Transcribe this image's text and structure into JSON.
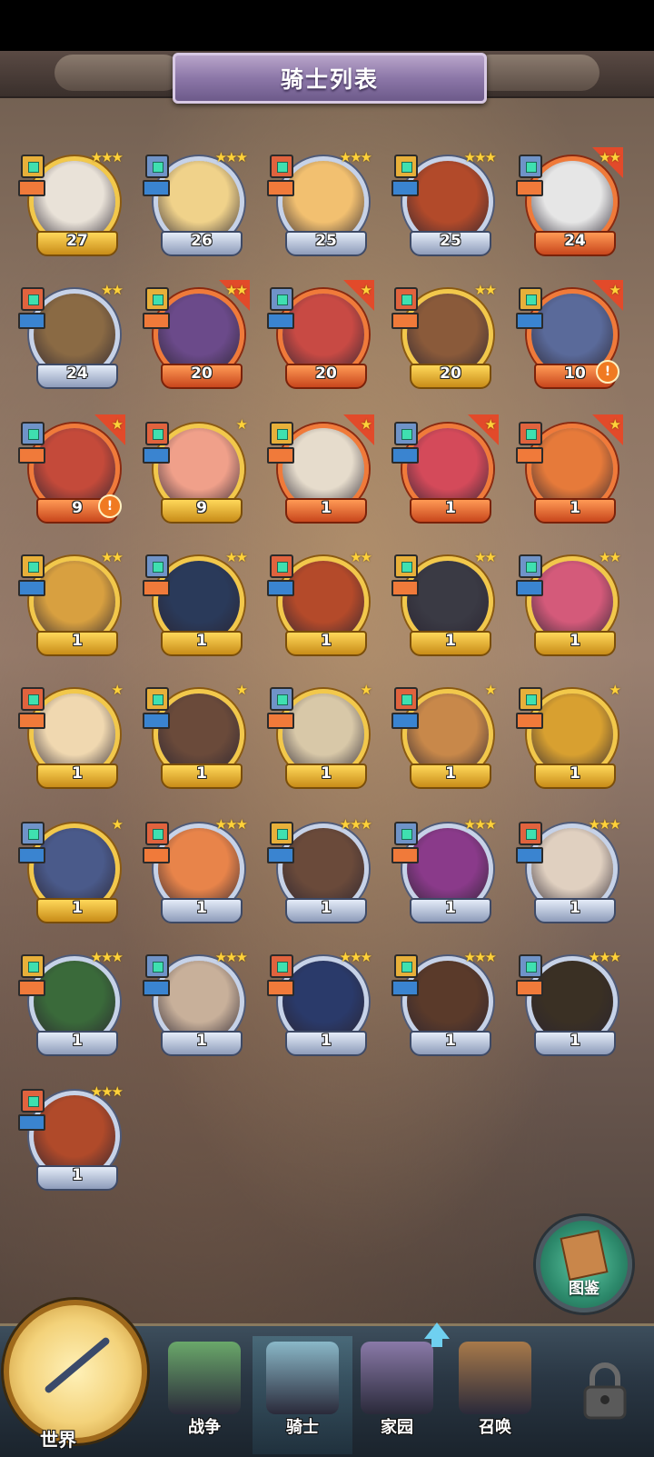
{
  "title": "骑士列表",
  "heroes": [
    {
      "level": "27",
      "stars": "★★★",
      "frame": "gold",
      "flag": false,
      "alert": false,
      "face": "#e9e2d8"
    },
    {
      "level": "26",
      "stars": "★★★",
      "frame": "silver",
      "flag": false,
      "alert": false,
      "face": "#f0d28a"
    },
    {
      "level": "25",
      "stars": "★★★",
      "frame": "silver",
      "flag": false,
      "alert": false,
      "face": "#f2c070"
    },
    {
      "level": "25",
      "stars": "★★★",
      "frame": "silver",
      "flag": false,
      "alert": false,
      "face": "#b24a2a"
    },
    {
      "level": "24",
      "stars": "★★",
      "frame": "red",
      "flag": true,
      "alert": false,
      "face": "#e6e6e6"
    },
    {
      "level": "24",
      "stars": "★★",
      "frame": "silver",
      "flag": false,
      "alert": false,
      "face": "#8a6a44"
    },
    {
      "level": "20",
      "stars": "★★",
      "frame": "red",
      "flag": true,
      "alert": false,
      "face": "#6b4a8a"
    },
    {
      "level": "20",
      "stars": "★",
      "frame": "red",
      "flag": true,
      "alert": false,
      "face": "#c84a44"
    },
    {
      "level": "20",
      "stars": "★★",
      "frame": "gold",
      "flag": false,
      "alert": false,
      "face": "#8a5a3a"
    },
    {
      "level": "10",
      "stars": "★",
      "frame": "red",
      "flag": true,
      "alert": true,
      "face": "#5a6a9a"
    },
    {
      "level": "9",
      "stars": "★",
      "frame": "red",
      "flag": true,
      "alert": true,
      "face": "#c44a3a"
    },
    {
      "level": "9",
      "stars": "★",
      "frame": "gold",
      "flag": false,
      "alert": false,
      "face": "#f0a08a"
    },
    {
      "level": "1",
      "stars": "★",
      "frame": "red",
      "flag": true,
      "alert": false,
      "face": "#e6dccc"
    },
    {
      "level": "1",
      "stars": "★",
      "frame": "red",
      "flag": true,
      "alert": false,
      "face": "#d44a5a"
    },
    {
      "level": "1",
      "stars": "★",
      "frame": "red",
      "flag": true,
      "alert": false,
      "face": "#e67a3a"
    },
    {
      "level": "1",
      "stars": "★★",
      "frame": "gold",
      "flag": false,
      "alert": false,
      "face": "#d8a040"
    },
    {
      "level": "1",
      "stars": "★★",
      "frame": "gold",
      "flag": false,
      "alert": false,
      "face": "#2a3a5a"
    },
    {
      "level": "1",
      "stars": "★★",
      "frame": "gold",
      "flag": false,
      "alert": false,
      "face": "#b44a2a"
    },
    {
      "level": "1",
      "stars": "★★",
      "frame": "gold",
      "flag": false,
      "alert": false,
      "face": "#3a3a44"
    },
    {
      "level": "1",
      "stars": "★★",
      "frame": "gold",
      "flag": false,
      "alert": false,
      "face": "#d45a7a"
    },
    {
      "level": "1",
      "stars": "★",
      "frame": "gold",
      "flag": false,
      "alert": false,
      "face": "#f0d8b0"
    },
    {
      "level": "1",
      "stars": "★",
      "frame": "gold",
      "flag": false,
      "alert": false,
      "face": "#6a4a3a"
    },
    {
      "level": "1",
      "stars": "★",
      "frame": "gold",
      "flag": false,
      "alert": false,
      "face": "#d8c8a8"
    },
    {
      "level": "1",
      "stars": "★",
      "frame": "gold",
      "flag": false,
      "alert": false,
      "face": "#c8884a"
    },
    {
      "level": "1",
      "stars": "★",
      "frame": "gold",
      "flag": false,
      "alert": false,
      "face": "#d8a030"
    },
    {
      "level": "1",
      "stars": "★",
      "frame": "gold",
      "flag": false,
      "alert": false,
      "face": "#4a5a8a"
    },
    {
      "level": "1",
      "stars": "★★★",
      "frame": "silver",
      "flag": false,
      "alert": false,
      "face": "#e8844a"
    },
    {
      "level": "1",
      "stars": "★★★",
      "frame": "silver",
      "flag": false,
      "alert": false,
      "face": "#6a4a3a"
    },
    {
      "level": "1",
      "stars": "★★★",
      "frame": "silver",
      "flag": false,
      "alert": false,
      "face": "#8a3a8a"
    },
    {
      "level": "1",
      "stars": "★★★",
      "frame": "silver",
      "flag": false,
      "alert": false,
      "face": "#e0d0c0"
    },
    {
      "level": "1",
      "stars": "★★★",
      "frame": "silver",
      "flag": false,
      "alert": false,
      "face": "#3a6a3a"
    },
    {
      "level": "1",
      "stars": "★★★",
      "frame": "silver",
      "flag": false,
      "alert": false,
      "face": "#c8b09a"
    },
    {
      "level": "1",
      "stars": "★★★",
      "frame": "silver",
      "flag": false,
      "alert": false,
      "face": "#2a3a6a"
    },
    {
      "level": "1",
      "stars": "★★★",
      "frame": "silver",
      "flag": false,
      "alert": false,
      "face": "#5a3a2a"
    },
    {
      "level": "1",
      "stars": "★★★",
      "frame": "silver",
      "flag": false,
      "alert": false,
      "face": "#3a3024"
    },
    {
      "level": "1",
      "stars": "★★★",
      "frame": "silver",
      "flag": false,
      "alert": false,
      "face": "#b04a2a"
    }
  ],
  "catalog_label": "图鉴",
  "nav": {
    "world": "世界",
    "items": [
      {
        "label": "战争",
        "icon": "map-icon",
        "color": "#6aa86a"
      },
      {
        "label": "骑士",
        "icon": "knight-icon",
        "color": "#8ab8c8"
      },
      {
        "label": "家园",
        "icon": "house-icon",
        "color": "#8a7aa8"
      },
      {
        "label": "召唤",
        "icon": "train-icon",
        "color": "#a87a4a"
      }
    ],
    "locked": "lock-icon"
  }
}
